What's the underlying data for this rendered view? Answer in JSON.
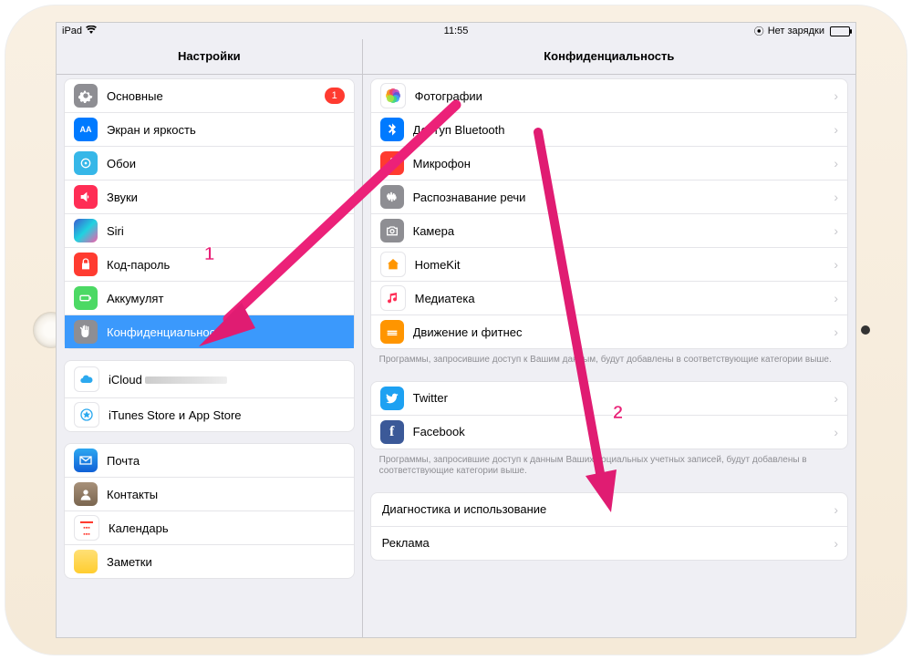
{
  "statusbar": {
    "device": "iPad",
    "time": "11:55",
    "battery_text": "Нет зарядки"
  },
  "left": {
    "title": "Настройки",
    "items": {
      "general": "Основные",
      "general_badge": "1",
      "brightness": "Экран и яркость",
      "wallpaper": "Обои",
      "sounds": "Звуки",
      "siri": "Siri",
      "passcode": "Код-пароль",
      "battery": "Аккумулят",
      "privacy": "Конфиденциальность",
      "icloud": "iCloud",
      "itunes": "iTunes Store и App Store",
      "mail": "Почта",
      "contacts": "Контакты",
      "calendar": "Календарь",
      "notes": "Заметки"
    }
  },
  "right": {
    "title": "Конфиденциальность",
    "group1": {
      "photos": "Фотографии",
      "bluetooth": "Доступ Bluetooth",
      "microphone": "Микрофон",
      "speech": "Распознавание речи",
      "camera": "Камера",
      "homekit": "HomeKit",
      "media": "Медиатека",
      "motion": "Движение и фитнес"
    },
    "footer1": "Программы, запросившие доступ к Вашим данным, будут добавлены в соответствующие категории выше.",
    "group2": {
      "twitter": "Twitter",
      "facebook": "Facebook"
    },
    "footer2": "Программы, запросившие доступ к данным Ваших социальных учетных записей, будут добавлены в соответствующие категории выше.",
    "group3": {
      "diag": "Диагностика и использование",
      "ads": "Реклама"
    }
  },
  "annotations": {
    "one": "1",
    "two": "2"
  }
}
